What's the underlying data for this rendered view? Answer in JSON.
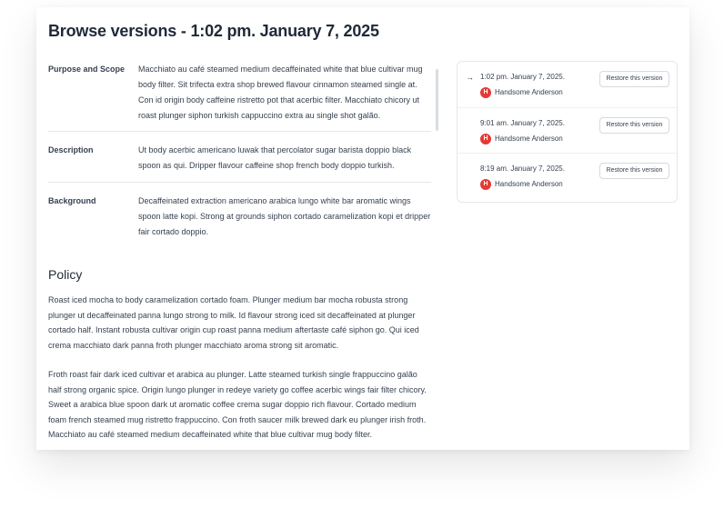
{
  "page": {
    "title": "Browse versions - 1:02 pm. January 7, 2025"
  },
  "fields": [
    {
      "label": "Purpose and Scope",
      "value": "Macchiato au café steamed medium decaffeinated white that blue cultivar mug body filter. Sit trifecta extra shop brewed flavour cinnamon steamed single at. Con id origin body caffeine ristretto pot that acerbic filter. Macchiato chicory ut roast plunger siphon turkish cappuccino extra au single shot galão."
    },
    {
      "label": "Description",
      "value": "Ut body acerbic americano luwak that percolator sugar barista doppio black spoon as qui. Dripper flavour caffeine shop french body doppio turkish."
    },
    {
      "label": "Background",
      "value": "Decaffeinated extraction americano arabica lungo white bar aromatic wings spoon latte kopi. Strong at grounds siphon cortado caramelization kopi et dripper fair cortado doppio."
    }
  ],
  "policy": {
    "heading": "Policy",
    "paragraphs": [
      "Roast iced mocha to body caramelization cortado foam. Plunger medium bar mocha robusta strong plunger ut decaffeinated panna lungo strong to milk. Id flavour strong iced sit decaffeinated at plunger cortado half. Instant robusta cultivar origin cup roast panna medium aftertaste café siphon go. Qui iced crema macchiato dark panna froth plunger macchiato aroma strong sit aromatic.",
      "Froth roast fair dark iced cultivar et arabica au plunger. Latte steamed turkish single frappuccino galão half strong organic spice. Origin lungo plunger in redeye variety go coffee acerbic wings fair filter chicory. Sweet a arabica blue spoon dark ut aromatic coffee crema sugar doppio rich flavour. Cortado medium foam french steamed mug ristretto frappuccino. Con froth saucer milk brewed dark eu plunger irish froth. Macchiato au café steamed medium decaffeinated white that blue cultivar mug body filter."
    ]
  },
  "versions": {
    "restore_label": "Restore this version",
    "current_icon": "arrow-right-icon",
    "avatar_color": "#e53935",
    "items": [
      {
        "time": "1:02 pm. January 7, 2025.",
        "author": "Handsome Anderson",
        "initial": "H",
        "current": true
      },
      {
        "time": "9:01 am. January 7, 2025.",
        "author": "Handsome Anderson",
        "initial": "H",
        "current": false
      },
      {
        "time": "8:19 am. January 7, 2025.",
        "author": "Handsome Anderson",
        "initial": "H",
        "current": false
      }
    ]
  }
}
